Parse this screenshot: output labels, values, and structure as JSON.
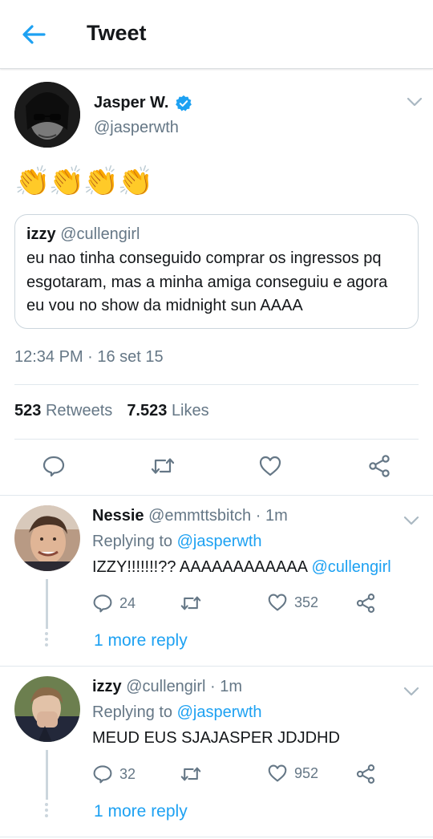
{
  "header": {
    "title": "Tweet"
  },
  "tweet": {
    "author_name": "Jasper W.",
    "author_handle": "@jasperwth",
    "emoji_text": "👏👏👏👏",
    "quote": {
      "name": "izzy",
      "handle": "@cullengirl",
      "text": "eu nao tinha conseguido comprar os ingressos pq esgotaram, mas a minha amiga conseguiu e agora eu vou no show da midnight sun AAAA"
    },
    "timestamp": "12:34 PM · 16 set 15",
    "retweets_count": "523",
    "retweets_label": "Retweets",
    "likes_count": "7.523",
    "likes_label": "Likes"
  },
  "replies": [
    {
      "name": "Nessie",
      "handle": "@emmttsbitch · 1m",
      "replying_prefix": "Replying to ",
      "replying_to": "@jasperwth",
      "text": "IZZY!!!!!!!?? AAAAAAAAAAAA ",
      "mention": "@cullengirl",
      "reply_count": "24",
      "like_count": "352",
      "more_reply": "1 more reply"
    },
    {
      "name": "izzy",
      "handle": "@cullengirl · 1m",
      "replying_prefix": "Replying to ",
      "replying_to": "@jasperwth",
      "text": "MEUD EUS SJAJASPER JDJDHD",
      "mention": "",
      "reply_count": "32",
      "like_count": "952",
      "more_reply": "1 more reply"
    }
  ],
  "colors": {
    "accent": "#1da1f2",
    "secondary_text": "#657786",
    "border": "#e1e8ed"
  },
  "icons": [
    "back-arrow-icon",
    "verified-badge-icon",
    "chevron-down-icon",
    "reply-icon",
    "retweet-icon",
    "like-icon",
    "share-icon"
  ]
}
